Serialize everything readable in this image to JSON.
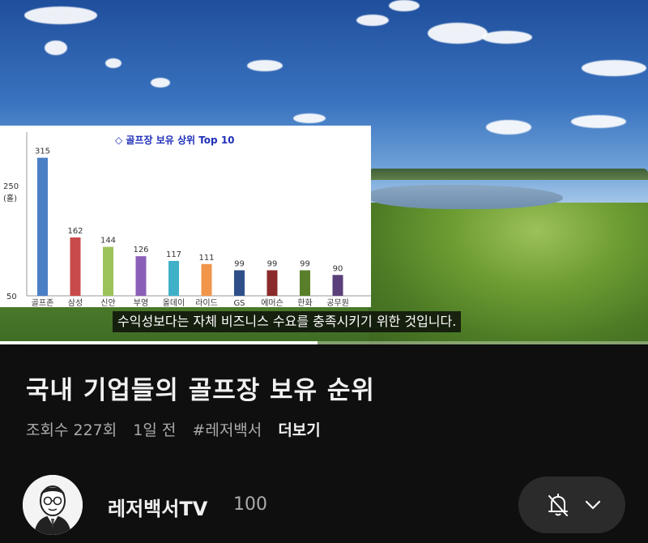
{
  "video": {
    "subtitle": "수익성보다는 자체 비즈니스 수요를 충족시키기 위한 것입니다.",
    "progress_fraction": 0.49
  },
  "chart_data": {
    "type": "bar",
    "title": "◇ 골프장 보유 상위 Top 10",
    "categories": [
      "골프존",
      "삼성",
      "신안",
      "부영",
      "올데이",
      "라이드",
      "GS",
      "에머슨",
      "한화",
      "공무원"
    ],
    "values": [
      315,
      162,
      144,
      126,
      117,
      111,
      99,
      99,
      99,
      90
    ],
    "colors": [
      "#4a7fc6",
      "#c94a4a",
      "#9cc25a",
      "#8a5fb8",
      "#3fb0c8",
      "#f0954a",
      "#2d4f8a",
      "#8a2a2a",
      "#5a7f2a",
      "#5a3f7a"
    ],
    "y_ticks": [
      "250",
      "50"
    ],
    "ylabel": "(홀)",
    "ylim": [
      50,
      330
    ]
  },
  "info": {
    "title": "국내 기업들의 골프장 보유 순위",
    "views": "조회수 227회",
    "age": "1일 전",
    "hashtag": "#레저백서",
    "more": "더보기"
  },
  "channel": {
    "name": "레저백서TV",
    "subscribers": "100"
  },
  "icons": {
    "bell": "bell-off-icon",
    "chevron": "chevron-down-icon"
  }
}
